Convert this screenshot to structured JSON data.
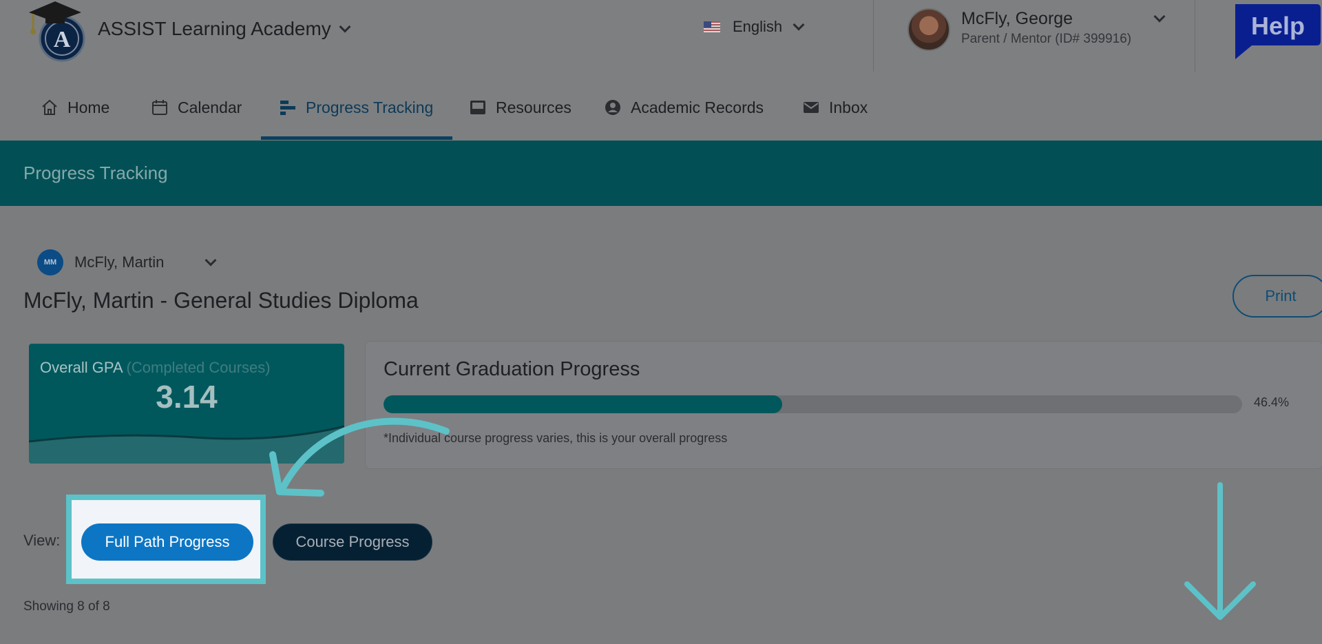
{
  "header": {
    "app_title": "ASSIST Learning Academy",
    "language": "English",
    "user_name": "McFly, George",
    "user_role": "Parent / Mentor (ID# 399916)",
    "help_label": "Help"
  },
  "nav": {
    "items": [
      {
        "label": "Home",
        "icon": "home-icon"
      },
      {
        "label": "Calendar",
        "icon": "calendar-icon"
      },
      {
        "label": "Progress Tracking",
        "icon": "progress-bars-icon",
        "active": true
      },
      {
        "label": "Resources",
        "icon": "inbox-tray-icon"
      },
      {
        "label": "Academic Records",
        "icon": "user-circle-icon"
      },
      {
        "label": "Inbox",
        "icon": "envelope-icon"
      }
    ]
  },
  "banner": {
    "title": "Progress Tracking"
  },
  "student": {
    "initials": "MM",
    "name": "McFly, Martin",
    "heading": "McFly, Martin - General Studies Diploma"
  },
  "print_label": "Print",
  "gpa": {
    "label": "Overall GPA",
    "qualifier": "(Completed Courses)",
    "value": "3.14"
  },
  "graduation": {
    "title": "Current Graduation Progress",
    "percent_label": "46.4%",
    "percent_value": 46.4,
    "note": "*Individual course progress varies, this is your overall progress"
  },
  "view": {
    "label": "View:",
    "full_path_label": "Full Path Progress",
    "course_label": "Course Progress"
  },
  "showing": "Showing 8 of 8",
  "colors": {
    "teal_banner": "#025055",
    "primary_blue": "#0d76c4",
    "annotation_teal": "#5cc2c8"
  }
}
